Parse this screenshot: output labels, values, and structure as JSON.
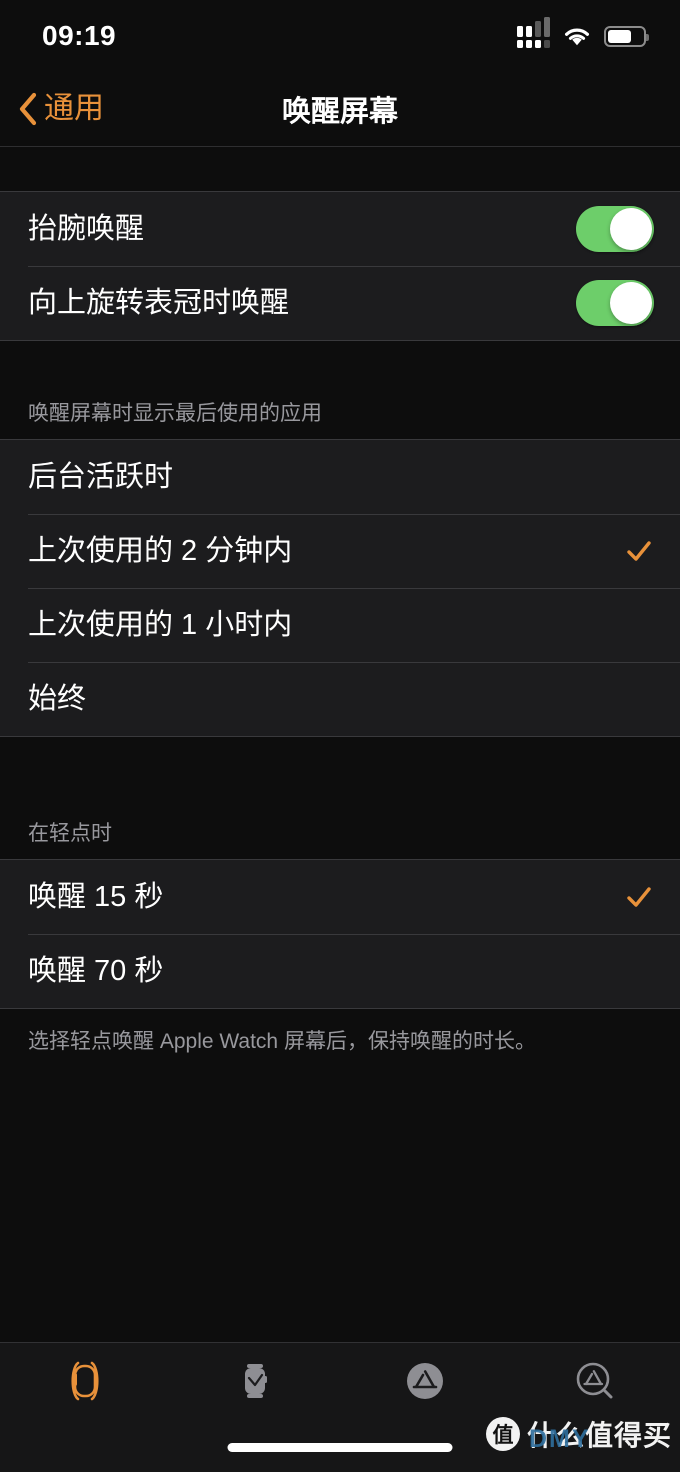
{
  "status_bar": {
    "time": "09:19",
    "signal_icon": "cellular-signal-icon",
    "wifi_icon": "wifi-icon",
    "battery_icon": "battery-icon",
    "battery_level_percent": 68
  },
  "nav": {
    "back_label": "通用",
    "back_icon": "chevron-left-icon",
    "title": "唤醒屏幕"
  },
  "colors": {
    "accent_orange": "#e8913a",
    "switch_on_green": "#6dce6a",
    "row_background": "#1c1c1e",
    "page_background": "#0d0d0d",
    "secondary_text": "#98989d"
  },
  "toggles_group": {
    "rows": [
      {
        "label": "抬腕唤醒",
        "state": "on"
      },
      {
        "label": "向上旋转表冠时唤醒",
        "state": "on"
      }
    ]
  },
  "last_app_group": {
    "header": "唤醒屏幕时显示最后使用的应用",
    "options": [
      {
        "label": "后台活跃时",
        "selected": false
      },
      {
        "label": "上次使用的 2 分钟内",
        "selected": true
      },
      {
        "label": "上次使用的 1 小时内",
        "selected": false
      },
      {
        "label": "始终",
        "selected": false
      }
    ]
  },
  "on_tap_group": {
    "header": "在轻点时",
    "options": [
      {
        "label": "唤醒 15 秒",
        "selected": true
      },
      {
        "label": "唤醒 70 秒",
        "selected": false
      }
    ],
    "footer": "选择轻点唤醒 Apple Watch 屏幕后，保持唤醒的时长。"
  },
  "tab_bar": {
    "tabs": [
      {
        "label": "我的手表",
        "icon": "watch-outline-icon",
        "active": true
      },
      {
        "label": "表盘图库",
        "icon": "watch-face-icon",
        "active": false
      },
      {
        "label": "App Store",
        "icon": "app-store-icon",
        "active": false
      },
      {
        "label": "搜索",
        "icon": "search-app-store-icon",
        "active": false
      }
    ]
  },
  "watermark": {
    "logo_char": "值",
    "text": "什么值得买",
    "sub_text": "DMY"
  }
}
